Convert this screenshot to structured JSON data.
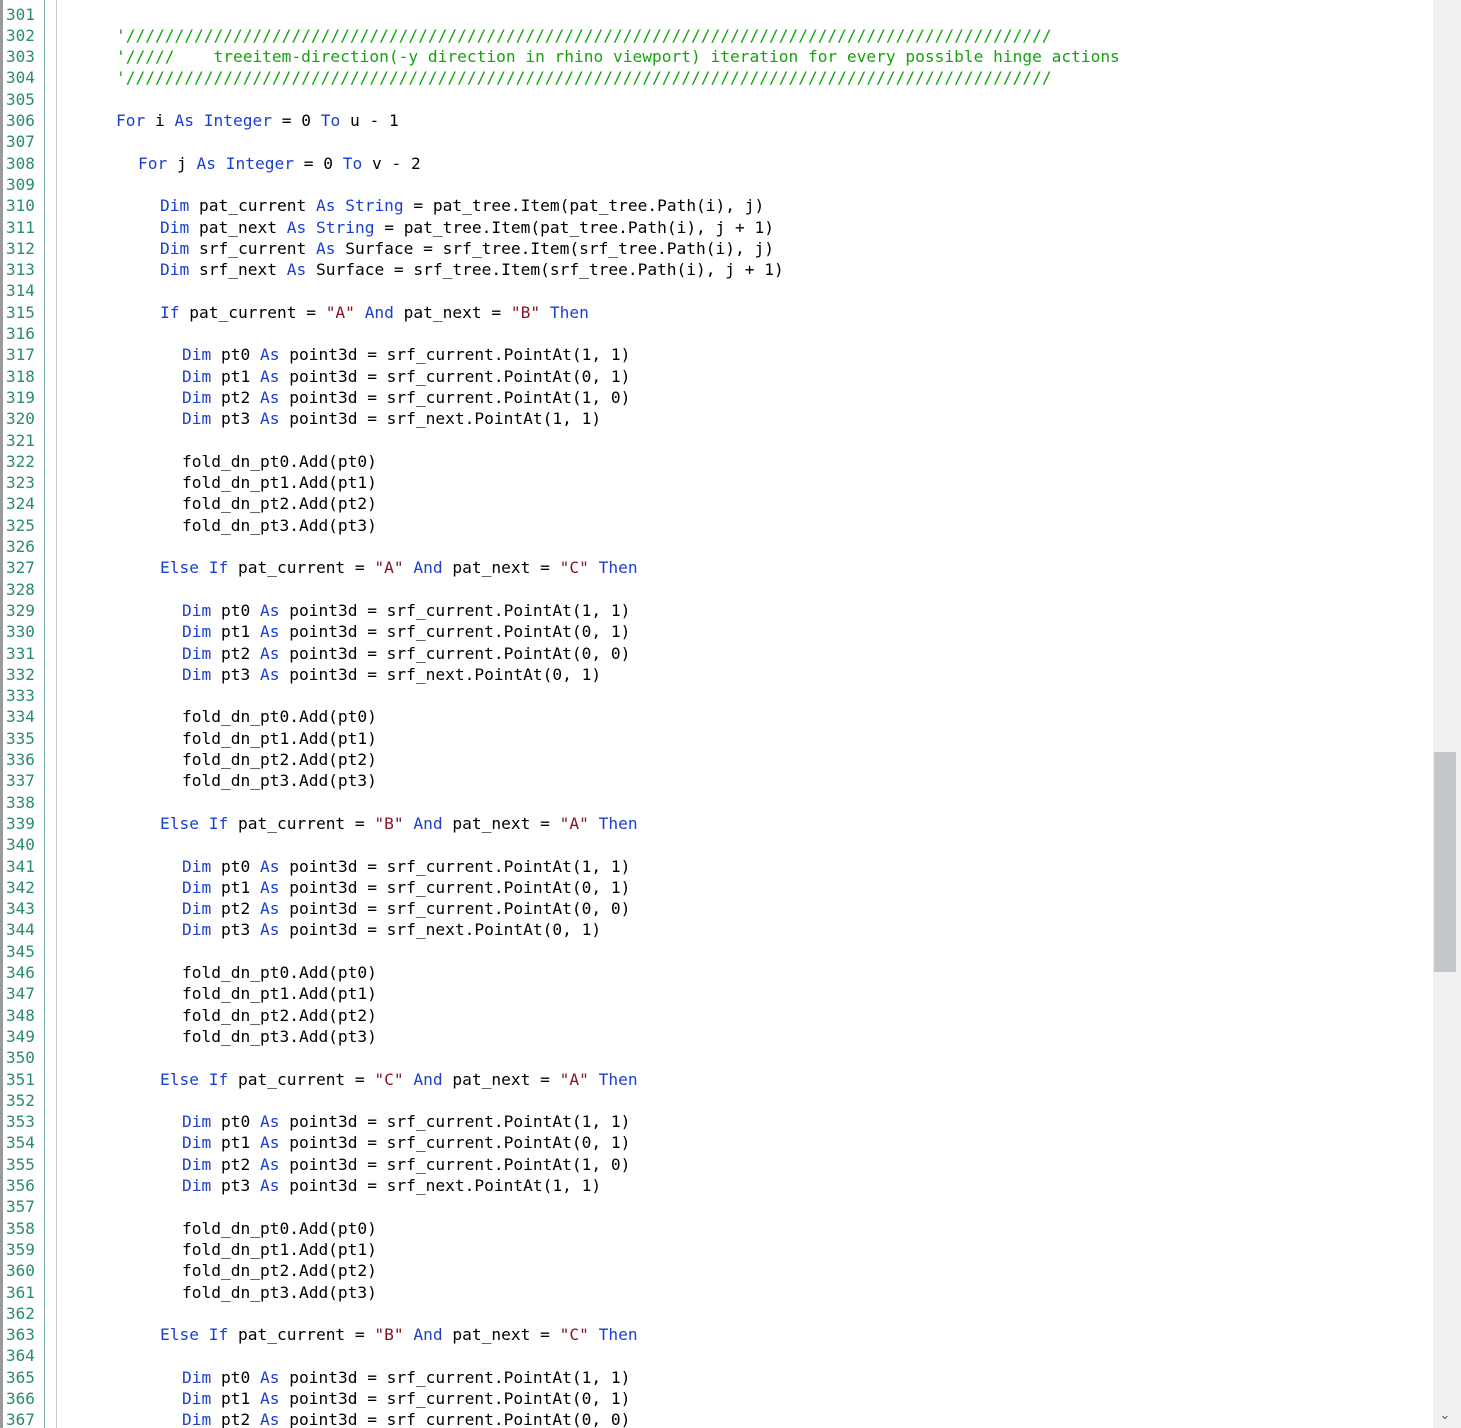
{
  "editor": {
    "first_line_number": 301,
    "scrollbar": {
      "position": 0.62,
      "thumb_fraction": 0.155
    },
    "colors": {
      "keyword": "#1a3fd1",
      "comment": "#16a30f",
      "string": "#8b1220",
      "line_number": "#2b8a73"
    },
    "scroll_down_icon": "chevron-down-icon",
    "lines": [
      {
        "n": "301",
        "indent": 0,
        "tokens": []
      },
      {
        "n": "302",
        "indent": 2,
        "tokens": [
          [
            "comment",
            "'///////////////////////////////////////////////////////////////////////////////////////////////"
          ]
        ]
      },
      {
        "n": "303",
        "indent": 2,
        "tokens": [
          [
            "comment",
            "'/////    treeitem-direction(-y direction in rhino viewport) iteration for every possible hinge actions"
          ]
        ]
      },
      {
        "n": "304",
        "indent": 2,
        "tokens": [
          [
            "comment",
            "'///////////////////////////////////////////////////////////////////////////////////////////////"
          ]
        ]
      },
      {
        "n": "305",
        "indent": 0,
        "tokens": []
      },
      {
        "n": "306",
        "indent": 2,
        "tokens": [
          [
            "keyword",
            "For"
          ],
          [
            "plain",
            " i "
          ],
          [
            "keyword",
            "As"
          ],
          [
            "plain",
            " "
          ],
          [
            "keyword",
            "Integer"
          ],
          [
            "plain",
            " = 0 "
          ],
          [
            "keyword",
            "To"
          ],
          [
            "plain",
            " u - 1"
          ]
        ]
      },
      {
        "n": "307",
        "indent": 0,
        "tokens": []
      },
      {
        "n": "308",
        "indent": 3,
        "tokens": [
          [
            "keyword",
            "For"
          ],
          [
            "plain",
            " j "
          ],
          [
            "keyword",
            "As"
          ],
          [
            "plain",
            " "
          ],
          [
            "keyword",
            "Integer"
          ],
          [
            "plain",
            " = 0 "
          ],
          [
            "keyword",
            "To"
          ],
          [
            "plain",
            " v - 2"
          ]
        ]
      },
      {
        "n": "309",
        "indent": 0,
        "tokens": []
      },
      {
        "n": "310",
        "indent": 4,
        "tokens": [
          [
            "keyword",
            "Dim"
          ],
          [
            "plain",
            " pat_current "
          ],
          [
            "keyword",
            "As"
          ],
          [
            "plain",
            " "
          ],
          [
            "keyword",
            "String"
          ],
          [
            "plain",
            " = pat_tree.Item(pat_tree.Path(i), j)"
          ]
        ]
      },
      {
        "n": "311",
        "indent": 4,
        "tokens": [
          [
            "keyword",
            "Dim"
          ],
          [
            "plain",
            " pat_next "
          ],
          [
            "keyword",
            "As"
          ],
          [
            "plain",
            " "
          ],
          [
            "keyword",
            "String"
          ],
          [
            "plain",
            " = pat_tree.Item(pat_tree.Path(i), j + 1)"
          ]
        ]
      },
      {
        "n": "312",
        "indent": 4,
        "tokens": [
          [
            "keyword",
            "Dim"
          ],
          [
            "plain",
            " srf_current "
          ],
          [
            "keyword",
            "As"
          ],
          [
            "plain",
            " Surface = srf_tree.Item(srf_tree.Path(i), j)"
          ]
        ]
      },
      {
        "n": "313",
        "indent": 4,
        "tokens": [
          [
            "keyword",
            "Dim"
          ],
          [
            "plain",
            " srf_next "
          ],
          [
            "keyword",
            "As"
          ],
          [
            "plain",
            " Surface = srf_tree.Item(srf_tree.Path(i), j + 1)"
          ]
        ]
      },
      {
        "n": "314",
        "indent": 0,
        "tokens": []
      },
      {
        "n": "315",
        "indent": 4,
        "tokens": [
          [
            "keyword",
            "If"
          ],
          [
            "plain",
            " pat_current = "
          ],
          [
            "string",
            "\"A\""
          ],
          [
            "plain",
            " "
          ],
          [
            "keyword",
            "And"
          ],
          [
            "plain",
            " pat_next = "
          ],
          [
            "string",
            "\"B\""
          ],
          [
            "plain",
            " "
          ],
          [
            "keyword",
            "Then"
          ]
        ]
      },
      {
        "n": "316",
        "indent": 0,
        "tokens": []
      },
      {
        "n": "317",
        "indent": 5,
        "tokens": [
          [
            "keyword",
            "Dim"
          ],
          [
            "plain",
            " pt0 "
          ],
          [
            "keyword",
            "As"
          ],
          [
            "plain",
            " point3d = srf_current.PointAt(1, 1)"
          ]
        ]
      },
      {
        "n": "318",
        "indent": 5,
        "tokens": [
          [
            "keyword",
            "Dim"
          ],
          [
            "plain",
            " pt1 "
          ],
          [
            "keyword",
            "As"
          ],
          [
            "plain",
            " point3d = srf_current.PointAt(0, 1)"
          ]
        ]
      },
      {
        "n": "319",
        "indent": 5,
        "tokens": [
          [
            "keyword",
            "Dim"
          ],
          [
            "plain",
            " pt2 "
          ],
          [
            "keyword",
            "As"
          ],
          [
            "plain",
            " point3d = srf_current.PointAt(1, 0)"
          ]
        ]
      },
      {
        "n": "320",
        "indent": 5,
        "tokens": [
          [
            "keyword",
            "Dim"
          ],
          [
            "plain",
            " pt3 "
          ],
          [
            "keyword",
            "As"
          ],
          [
            "plain",
            " point3d = srf_next.PointAt(1, 1)"
          ]
        ]
      },
      {
        "n": "321",
        "indent": 0,
        "tokens": []
      },
      {
        "n": "322",
        "indent": 5,
        "tokens": [
          [
            "plain",
            "fold_dn_pt0.Add(pt0)"
          ]
        ]
      },
      {
        "n": "323",
        "indent": 5,
        "tokens": [
          [
            "plain",
            "fold_dn_pt1.Add(pt1)"
          ]
        ]
      },
      {
        "n": "324",
        "indent": 5,
        "tokens": [
          [
            "plain",
            "fold_dn_pt2.Add(pt2)"
          ]
        ]
      },
      {
        "n": "325",
        "indent": 5,
        "tokens": [
          [
            "plain",
            "fold_dn_pt3.Add(pt3)"
          ]
        ]
      },
      {
        "n": "326",
        "indent": 0,
        "tokens": []
      },
      {
        "n": "327",
        "indent": 4,
        "tokens": [
          [
            "keyword",
            "Else"
          ],
          [
            "plain",
            " "
          ],
          [
            "keyword",
            "If"
          ],
          [
            "plain",
            " pat_current = "
          ],
          [
            "string",
            "\"A\""
          ],
          [
            "plain",
            " "
          ],
          [
            "keyword",
            "And"
          ],
          [
            "plain",
            " pat_next = "
          ],
          [
            "string",
            "\"C\""
          ],
          [
            "plain",
            " "
          ],
          [
            "keyword",
            "Then"
          ]
        ]
      },
      {
        "n": "328",
        "indent": 0,
        "tokens": []
      },
      {
        "n": "329",
        "indent": 5,
        "tokens": [
          [
            "keyword",
            "Dim"
          ],
          [
            "plain",
            " pt0 "
          ],
          [
            "keyword",
            "As"
          ],
          [
            "plain",
            " point3d = srf_current.PointAt(1, 1)"
          ]
        ]
      },
      {
        "n": "330",
        "indent": 5,
        "tokens": [
          [
            "keyword",
            "Dim"
          ],
          [
            "plain",
            " pt1 "
          ],
          [
            "keyword",
            "As"
          ],
          [
            "plain",
            " point3d = srf_current.PointAt(0, 1)"
          ]
        ]
      },
      {
        "n": "331",
        "indent": 5,
        "tokens": [
          [
            "keyword",
            "Dim"
          ],
          [
            "plain",
            " pt2 "
          ],
          [
            "keyword",
            "As"
          ],
          [
            "plain",
            " point3d = srf_current.PointAt(0, 0)"
          ]
        ]
      },
      {
        "n": "332",
        "indent": 5,
        "tokens": [
          [
            "keyword",
            "Dim"
          ],
          [
            "plain",
            " pt3 "
          ],
          [
            "keyword",
            "As"
          ],
          [
            "plain",
            " point3d = srf_next.PointAt(0, 1)"
          ]
        ]
      },
      {
        "n": "333",
        "indent": 0,
        "tokens": []
      },
      {
        "n": "334",
        "indent": 5,
        "tokens": [
          [
            "plain",
            "fold_dn_pt0.Add(pt0)"
          ]
        ]
      },
      {
        "n": "335",
        "indent": 5,
        "tokens": [
          [
            "plain",
            "fold_dn_pt1.Add(pt1)"
          ]
        ]
      },
      {
        "n": "336",
        "indent": 5,
        "tokens": [
          [
            "plain",
            "fold_dn_pt2.Add(pt2)"
          ]
        ]
      },
      {
        "n": "337",
        "indent": 5,
        "tokens": [
          [
            "plain",
            "fold_dn_pt3.Add(pt3)"
          ]
        ]
      },
      {
        "n": "338",
        "indent": 0,
        "tokens": []
      },
      {
        "n": "339",
        "indent": 4,
        "tokens": [
          [
            "keyword",
            "Else"
          ],
          [
            "plain",
            " "
          ],
          [
            "keyword",
            "If"
          ],
          [
            "plain",
            " pat_current = "
          ],
          [
            "string",
            "\"B\""
          ],
          [
            "plain",
            " "
          ],
          [
            "keyword",
            "And"
          ],
          [
            "plain",
            " pat_next = "
          ],
          [
            "string",
            "\"A\""
          ],
          [
            "plain",
            " "
          ],
          [
            "keyword",
            "Then"
          ]
        ]
      },
      {
        "n": "340",
        "indent": 0,
        "tokens": []
      },
      {
        "n": "341",
        "indent": 5,
        "tokens": [
          [
            "keyword",
            "Dim"
          ],
          [
            "plain",
            " pt0 "
          ],
          [
            "keyword",
            "As"
          ],
          [
            "plain",
            " point3d = srf_current.PointAt(1, 1)"
          ]
        ]
      },
      {
        "n": "342",
        "indent": 5,
        "tokens": [
          [
            "keyword",
            "Dim"
          ],
          [
            "plain",
            " pt1 "
          ],
          [
            "keyword",
            "As"
          ],
          [
            "plain",
            " point3d = srf_current.PointAt(0, 1)"
          ]
        ]
      },
      {
        "n": "343",
        "indent": 5,
        "tokens": [
          [
            "keyword",
            "Dim"
          ],
          [
            "plain",
            " pt2 "
          ],
          [
            "keyword",
            "As"
          ],
          [
            "plain",
            " point3d = srf_current.PointAt(0, 0)"
          ]
        ]
      },
      {
        "n": "344",
        "indent": 5,
        "tokens": [
          [
            "keyword",
            "Dim"
          ],
          [
            "plain",
            " pt3 "
          ],
          [
            "keyword",
            "As"
          ],
          [
            "plain",
            " point3d = srf_next.PointAt(0, 1)"
          ]
        ]
      },
      {
        "n": "345",
        "indent": 0,
        "tokens": []
      },
      {
        "n": "346",
        "indent": 5,
        "tokens": [
          [
            "plain",
            "fold_dn_pt0.Add(pt0)"
          ]
        ]
      },
      {
        "n": "347",
        "indent": 5,
        "tokens": [
          [
            "plain",
            "fold_dn_pt1.Add(pt1)"
          ]
        ]
      },
      {
        "n": "348",
        "indent": 5,
        "tokens": [
          [
            "plain",
            "fold_dn_pt2.Add(pt2)"
          ]
        ]
      },
      {
        "n": "349",
        "indent": 5,
        "tokens": [
          [
            "plain",
            "fold_dn_pt3.Add(pt3)"
          ]
        ]
      },
      {
        "n": "350",
        "indent": 0,
        "tokens": []
      },
      {
        "n": "351",
        "indent": 4,
        "tokens": [
          [
            "keyword",
            "Else"
          ],
          [
            "plain",
            " "
          ],
          [
            "keyword",
            "If"
          ],
          [
            "plain",
            " pat_current = "
          ],
          [
            "string",
            "\"C\""
          ],
          [
            "plain",
            " "
          ],
          [
            "keyword",
            "And"
          ],
          [
            "plain",
            " pat_next = "
          ],
          [
            "string",
            "\"A\""
          ],
          [
            "plain",
            " "
          ],
          [
            "keyword",
            "Then"
          ]
        ]
      },
      {
        "n": "352",
        "indent": 0,
        "tokens": []
      },
      {
        "n": "353",
        "indent": 5,
        "tokens": [
          [
            "keyword",
            "Dim"
          ],
          [
            "plain",
            " pt0 "
          ],
          [
            "keyword",
            "As"
          ],
          [
            "plain",
            " point3d = srf_current.PointAt(1, 1)"
          ]
        ]
      },
      {
        "n": "354",
        "indent": 5,
        "tokens": [
          [
            "keyword",
            "Dim"
          ],
          [
            "plain",
            " pt1 "
          ],
          [
            "keyword",
            "As"
          ],
          [
            "plain",
            " point3d = srf_current.PointAt(0, 1)"
          ]
        ]
      },
      {
        "n": "355",
        "indent": 5,
        "tokens": [
          [
            "keyword",
            "Dim"
          ],
          [
            "plain",
            " pt2 "
          ],
          [
            "keyword",
            "As"
          ],
          [
            "plain",
            " point3d = srf_current.PointAt(1, 0)"
          ]
        ]
      },
      {
        "n": "356",
        "indent": 5,
        "tokens": [
          [
            "keyword",
            "Dim"
          ],
          [
            "plain",
            " pt3 "
          ],
          [
            "keyword",
            "As"
          ],
          [
            "plain",
            " point3d = srf_next.PointAt(1, 1)"
          ]
        ]
      },
      {
        "n": "357",
        "indent": 0,
        "tokens": []
      },
      {
        "n": "358",
        "indent": 5,
        "tokens": [
          [
            "plain",
            "fold_dn_pt0.Add(pt0)"
          ]
        ]
      },
      {
        "n": "359",
        "indent": 5,
        "tokens": [
          [
            "plain",
            "fold_dn_pt1.Add(pt1)"
          ]
        ]
      },
      {
        "n": "360",
        "indent": 5,
        "tokens": [
          [
            "plain",
            "fold_dn_pt2.Add(pt2)"
          ]
        ]
      },
      {
        "n": "361",
        "indent": 5,
        "tokens": [
          [
            "plain",
            "fold_dn_pt3.Add(pt3)"
          ]
        ]
      },
      {
        "n": "362",
        "indent": 0,
        "tokens": []
      },
      {
        "n": "363",
        "indent": 4,
        "tokens": [
          [
            "keyword",
            "Else"
          ],
          [
            "plain",
            " "
          ],
          [
            "keyword",
            "If"
          ],
          [
            "plain",
            " pat_current = "
          ],
          [
            "string",
            "\"B\""
          ],
          [
            "plain",
            " "
          ],
          [
            "keyword",
            "And"
          ],
          [
            "plain",
            " pat_next = "
          ],
          [
            "string",
            "\"C\""
          ],
          [
            "plain",
            " "
          ],
          [
            "keyword",
            "Then"
          ]
        ]
      },
      {
        "n": "364",
        "indent": 0,
        "tokens": []
      },
      {
        "n": "365",
        "indent": 5,
        "tokens": [
          [
            "keyword",
            "Dim"
          ],
          [
            "plain",
            " pt0 "
          ],
          [
            "keyword",
            "As"
          ],
          [
            "plain",
            " point3d = srf_current.PointAt(1, 1)"
          ]
        ]
      },
      {
        "n": "366",
        "indent": 5,
        "tokens": [
          [
            "keyword",
            "Dim"
          ],
          [
            "plain",
            " pt1 "
          ],
          [
            "keyword",
            "As"
          ],
          [
            "plain",
            " point3d = srf_current.PointAt(0, 1)"
          ]
        ]
      },
      {
        "n": "367",
        "indent": 5,
        "tokens": [
          [
            "keyword",
            "Dim"
          ],
          [
            "plain",
            " pt2 "
          ],
          [
            "keyword",
            "As"
          ],
          [
            "plain",
            " point3d = srf_current.PointAt(0, 0)"
          ]
        ]
      }
    ]
  }
}
